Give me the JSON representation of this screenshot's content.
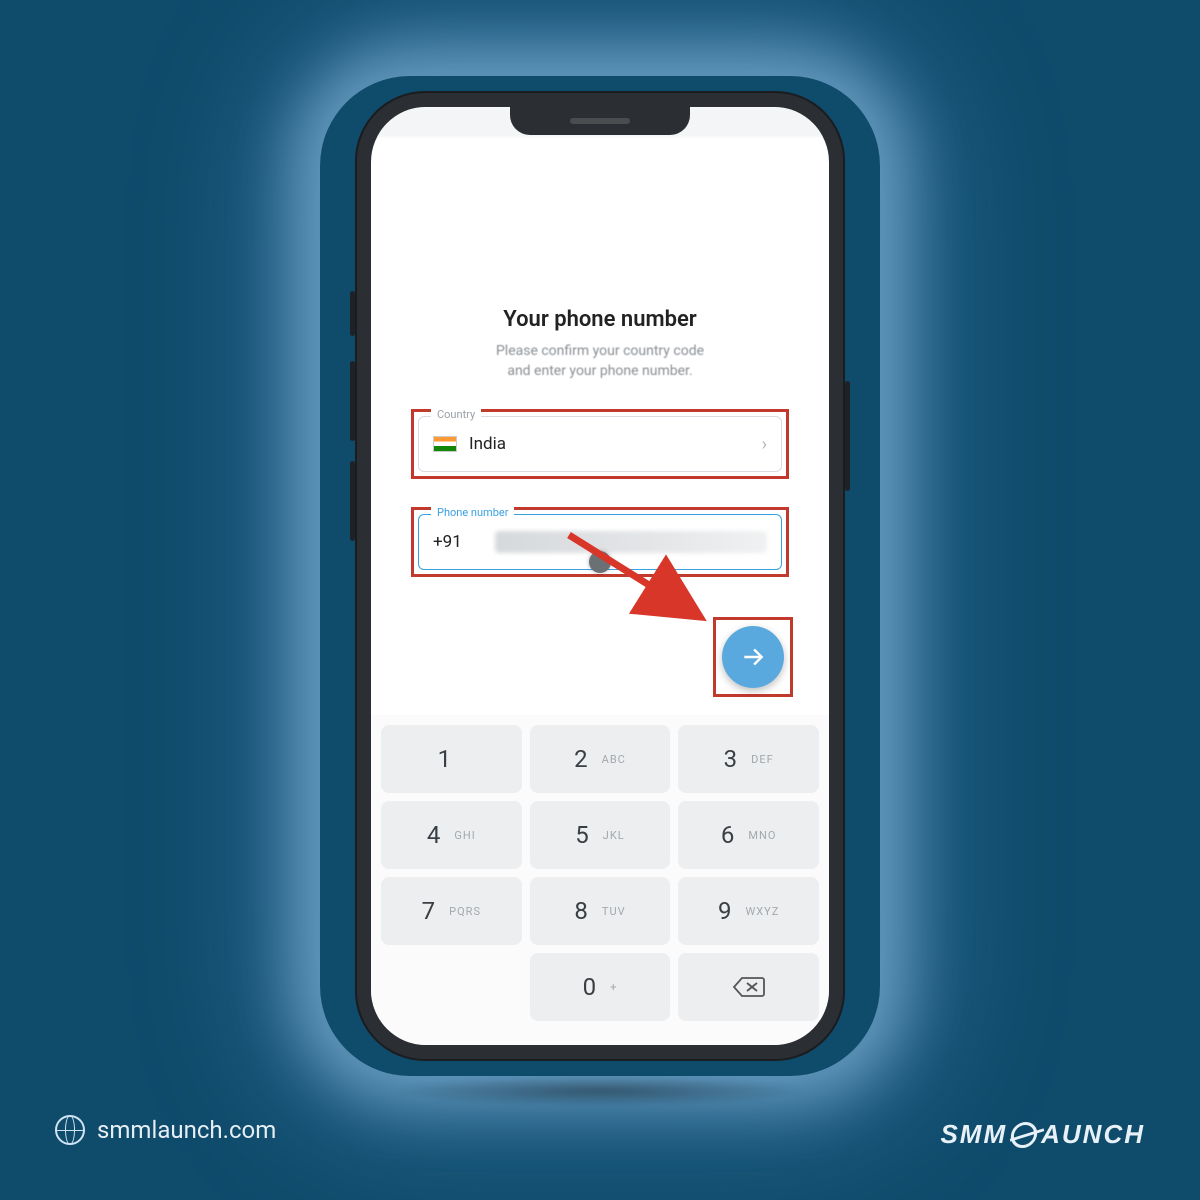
{
  "screen": {
    "title": "Your phone number",
    "subtitle_line1": "Please confirm your country code",
    "subtitle_line2": "and enter your phone number."
  },
  "country_field": {
    "label": "Country",
    "selected": "India"
  },
  "phone_field": {
    "label": "Phone number",
    "code": "+91"
  },
  "keypad": {
    "keys": [
      {
        "num": "1",
        "let": ""
      },
      {
        "num": "2",
        "let": "ABC"
      },
      {
        "num": "3",
        "let": "DEF"
      },
      {
        "num": "4",
        "let": "GHI"
      },
      {
        "num": "5",
        "let": "JKL"
      },
      {
        "num": "6",
        "let": "MNO"
      },
      {
        "num": "7",
        "let": "PQRS"
      },
      {
        "num": "8",
        "let": "TUV"
      },
      {
        "num": "9",
        "let": "WXYZ"
      },
      {
        "num": "0",
        "let": "+"
      }
    ]
  },
  "branding": {
    "site": "smmlaunch.com",
    "logo_left": "SMM",
    "logo_right": "AUNCH"
  },
  "colors": {
    "bg": "#0f4b6b",
    "highlight": "#c23a2e",
    "accent": "#5aa9de"
  }
}
